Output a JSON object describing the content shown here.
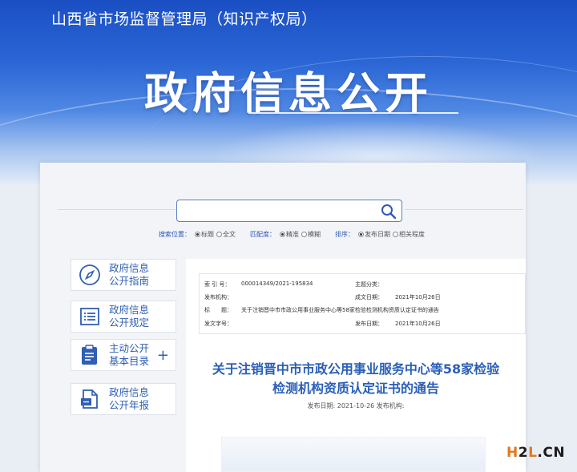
{
  "header": {
    "agency": "山西省市场监督管理局（知识产权局）",
    "title": "政府信息公开"
  },
  "search": {
    "value": "",
    "placeholder": "",
    "scope_label": "搜索位置：",
    "scope_options": [
      "标题",
      "全文"
    ],
    "match_label": "匹配度：",
    "match_options": [
      "精准",
      "模糊"
    ],
    "sort_label": "排序：",
    "sort_options": [
      "发布日期",
      "相关程度"
    ]
  },
  "sidebar": {
    "items": [
      {
        "line1": "政府信息",
        "line2": "公开指南",
        "icon": "compass-icon"
      },
      {
        "line1": "政府信息",
        "line2": "公开规定",
        "icon": "list-icon"
      },
      {
        "line1": "主动公开",
        "line2": "基本目录",
        "icon": "clipboard-icon",
        "expand": "+"
      },
      {
        "line1": "政府信息",
        "line2": "公开年报",
        "icon": "report-icon"
      }
    ]
  },
  "meta": {
    "index_label": "索 引 号：",
    "index_value": "000014349/2021-195834",
    "topic_label": "主题分类：",
    "topic_value": "",
    "issuer_label": "发布机构：",
    "issuer_value": "",
    "created_label": "成文日期：",
    "created_value": "2021年10月26日",
    "title_label": "标　　题：",
    "title_value": "关于注销晋中市市政公用事业服务中心等58家检验检测机构资质认定证书的通告",
    "docno_label": "发文字号：",
    "docno_value": "",
    "published_label": "发布日期：",
    "published_value": "2021年10月26日"
  },
  "document": {
    "title_line1": "关于注销晋中市市政公用事业服务中心等58家检验",
    "title_line2": "检测机构资质认定证书的通告",
    "subline": "发布日期: 2021-10-26 发布机构:"
  },
  "watermark": {
    "h": "H",
    "two": "2",
    "l": "L",
    "dot": ".",
    "cn": "CN"
  },
  "colors": {
    "accent": "#2f5fb4",
    "banner_top": "#1a4fc4",
    "watermark_orange": "#e07a1d"
  }
}
